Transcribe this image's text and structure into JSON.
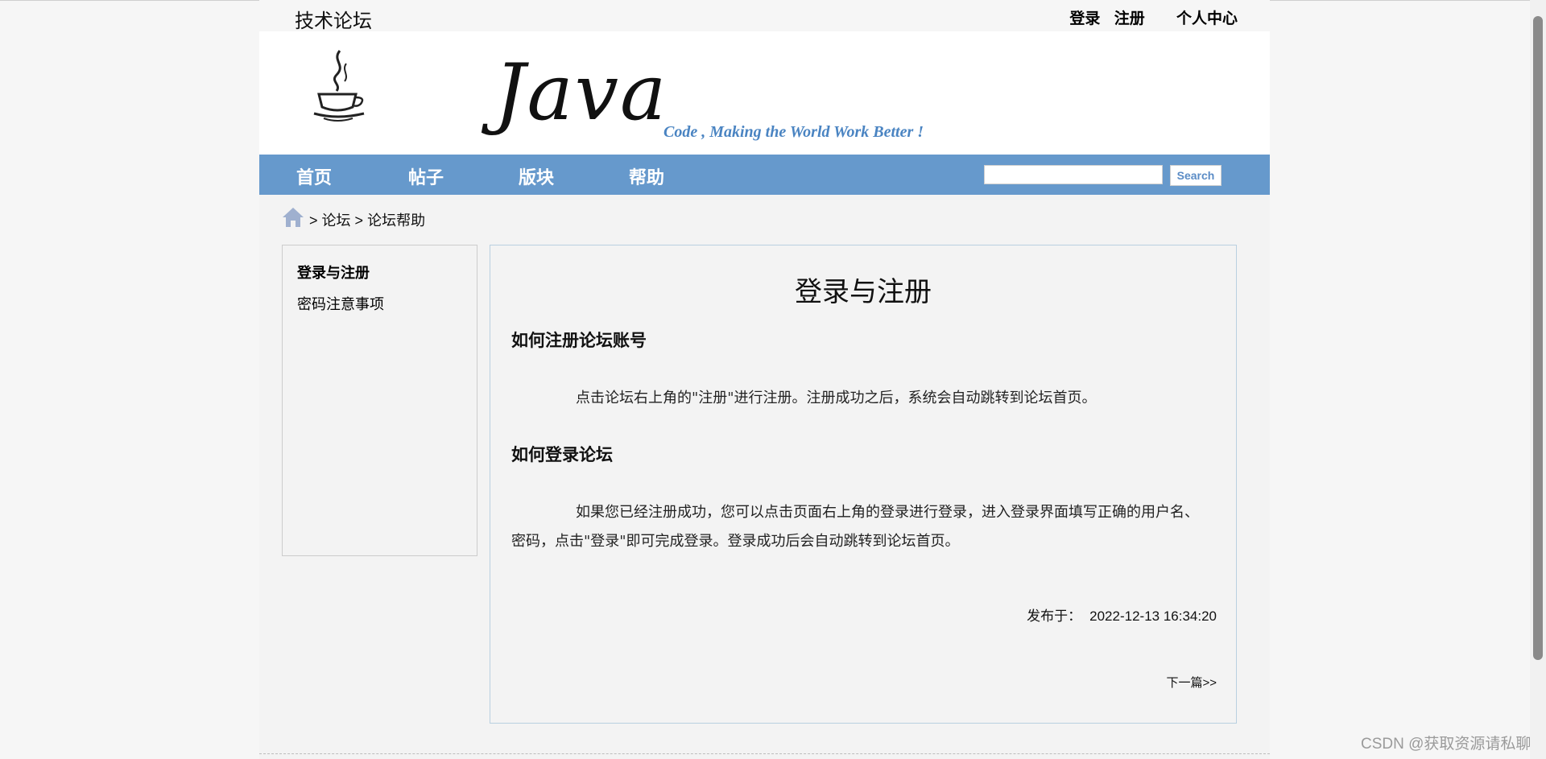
{
  "header": {
    "site_title": "技术论坛",
    "links": {
      "login": "登录",
      "register": "注册",
      "profile": "个人中心"
    }
  },
  "banner": {
    "logo_word": "Java",
    "slogan": "Code , Making the World Work Better !"
  },
  "nav": {
    "items": [
      "首页",
      "帖子",
      "版块",
      "帮助"
    ],
    "search": {
      "value": "",
      "placeholder": "",
      "button": "Search"
    }
  },
  "breadcrumb": {
    "sep": ">",
    "items": [
      "论坛",
      "论坛帮助"
    ]
  },
  "sidebar": {
    "items": [
      "登录与注册",
      "密码注意事项"
    ],
    "active_index": 0
  },
  "article": {
    "title": "登录与注册",
    "sections": [
      {
        "heading": "如何注册论坛账号",
        "body": "点击论坛右上角的\"注册\"进行注册。注册成功之后，系统会自动跳转到论坛首页。"
      },
      {
        "heading": "如何登录论坛",
        "body": "如果您已经注册成功，您可以点击页面右上角的登录进行登录，进入登录界面填写正确的用户名、密码，点击\"登录\"即可完成登录。登录成功后会自动跳转到论坛首页。"
      }
    ],
    "published_label": "发布于：",
    "published_time": "2022-12-13 16:34:20",
    "next_link": "下一篇>>"
  },
  "watermark": "CSDN @获取资源请私聊",
  "colors": {
    "nav_bg": "#6699cc",
    "slogan": "#4a84c2",
    "search_button_text": "#5b8cc6",
    "page_bg": "#f3f3f3"
  },
  "icons": {
    "home": "home-icon",
    "logo": "java-cup-icon"
  }
}
